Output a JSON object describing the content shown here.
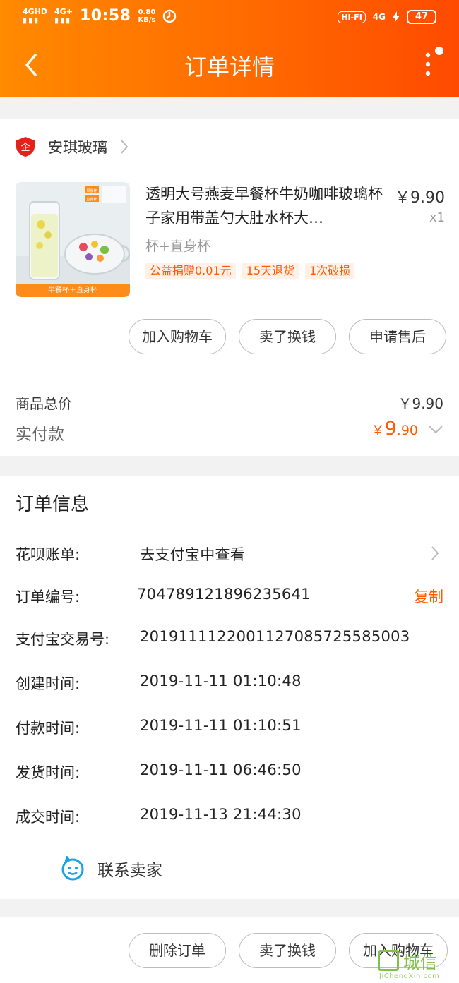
{
  "status_bar": {
    "signal1": "4GHD",
    "signal2": "4G+",
    "time": "10:58",
    "speed_value": "0.80",
    "speed_unit": "KB/s",
    "hifi": "HI-FI",
    "net": "4G",
    "battery": "47"
  },
  "header": {
    "title": "订单详情",
    "back_icon": "chevron-left-icon",
    "more_icon": "vertical-dots-icon"
  },
  "shop": {
    "name": "安琪玻璃",
    "badge_text": "企",
    "badge_color": "#e2231a"
  },
  "product": {
    "title": "透明大号燕麦早餐杯牛奶咖啡玻璃杯子家用带盖勺大肚水杯大…",
    "price": "￥9.90",
    "quantity": "x1",
    "sku": "杯+直身杯",
    "thumb_caption": "早餐杯＋直身杯",
    "thumb_label1": "早餐杯",
    "thumb_label2": "直身杯",
    "tags": [
      "公益捐赠0.01元",
      "15天退货",
      "1次破损"
    ]
  },
  "item_actions": [
    "加入购物车",
    "卖了换钱",
    "申请售后"
  ],
  "summary": {
    "total_label": "商品总价",
    "total_value": "￥9.90",
    "paid_label": "实付款",
    "paid_currency": "￥",
    "paid_int": "9",
    "paid_dec": ".90",
    "accent": "#ff5a00"
  },
  "order_info": {
    "title": "订单信息",
    "rows": [
      {
        "label": "花呗账单:",
        "value": "去支付宝中查看"
      },
      {
        "label": "订单编号:",
        "value": "704789121896235641"
      },
      {
        "label": "支付宝交易号:",
        "value": "2019111122001127085725585003"
      },
      {
        "label": "创建时间:",
        "value": "2019-11-11 01:10:48"
      },
      {
        "label": "付款时间:",
        "value": "2019-11-11 01:10:51"
      },
      {
        "label": "发货时间:",
        "value": "2019-11-11 06:46:50"
      },
      {
        "label": "成交时间:",
        "value": "2019-11-13 21:44:30"
      }
    ],
    "copy_label": "复制"
  },
  "contact": {
    "label": "联系卖家",
    "icon": "chat-face-icon"
  },
  "bottom_actions": [
    "删除订单",
    "卖了换钱",
    "加入购物车"
  ],
  "watermark": {
    "text": "城信",
    "sub": "JiChengXin.com"
  }
}
